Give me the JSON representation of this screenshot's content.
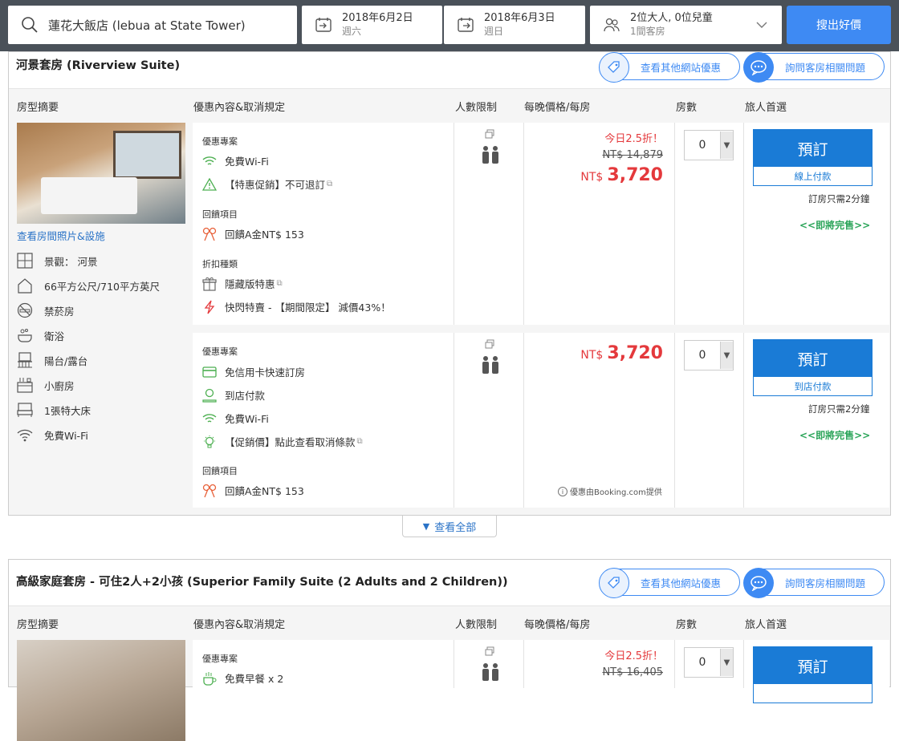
{
  "search": {
    "hotel": "蓮花大飯店 (lebua at State Tower)",
    "checkin_date": "2018年6月2日",
    "checkin_day": "週六",
    "checkout_date": "2018年6月3日",
    "checkout_day": "週日",
    "guests": "2位大人, 0位兒童",
    "rooms": "1間客房",
    "button": "搜出好價"
  },
  "headers": {
    "room_summary": "房型摘要",
    "offers": "優惠內容&取消規定",
    "occupancy": "人數限制",
    "price": "每晚價格/每房",
    "rooms": "房數",
    "choice": "旅人首選"
  },
  "pills": {
    "other_sites": "查看其他網站優惠",
    "ask": "詢問客房相關問題"
  },
  "room1": {
    "title": "河景套房 (Riverview Suite)",
    "photo_link": "查看房間照片&設施",
    "amenities": [
      "景觀： 河景",
      "66平方公尺/710平方英尺",
      "禁菸房",
      "衛浴",
      "陽台/露台",
      "小廚房",
      "1張特大床",
      "免費Wi-Fi"
    ],
    "offer1": {
      "deal_title": "優惠專案",
      "wifi": "免費Wi-Fi",
      "promo": "【特惠促銷】不可退訂",
      "cashback_title": "回饋項目",
      "cashback": "回饋A金NT$ 153",
      "discount_title": "折扣種類",
      "hidden": "隱藏版特惠",
      "flash": "快閃特賣 - 【期間限定】 減價43%！",
      "discount_badge": "今日2.5折！",
      "old_price": "NT$ 14,879",
      "currency": "NT$",
      "price": "3,720",
      "rooms_value": "0",
      "book": "預訂",
      "pay": "線上付款",
      "note": "訂房只需2分鐘",
      "sold": "<<即將完售>>"
    },
    "offer2": {
      "deal_title": "優惠專案",
      "no_card": "免信用卡快速訂房",
      "pay_hotel": "到店付款",
      "wifi": "免費Wi-Fi",
      "promo": "【促銷價】點此查看取消條款",
      "cashback_title": "回饋項目",
      "cashback": "回饋A金NT$ 153",
      "currency": "NT$",
      "price": "3,720",
      "booking_note": "優惠由Booking.com提供",
      "rooms_value": "0",
      "book": "預訂",
      "pay": "到店付款",
      "note": "訂房只需2分鐘",
      "sold": "<<即將完售>>"
    },
    "show_all": "查看全部"
  },
  "room2": {
    "title": "高級家庭套房 - 可住2人+2小孩 (Superior Family Suite (2 Adults and 2 Children))",
    "offer1": {
      "deal_title": "優惠專案",
      "breakfast": "免費早餐 x 2",
      "discount_badge": "今日2.5折！",
      "old_price": "NT$ 16,405",
      "rooms_value": "0",
      "book": "預訂"
    }
  },
  "colors": {
    "accent": "#3e8af3",
    "book_blue": "#1a7bd6",
    "price_red": "#e4393c",
    "sold_green": "#2ca55a"
  }
}
